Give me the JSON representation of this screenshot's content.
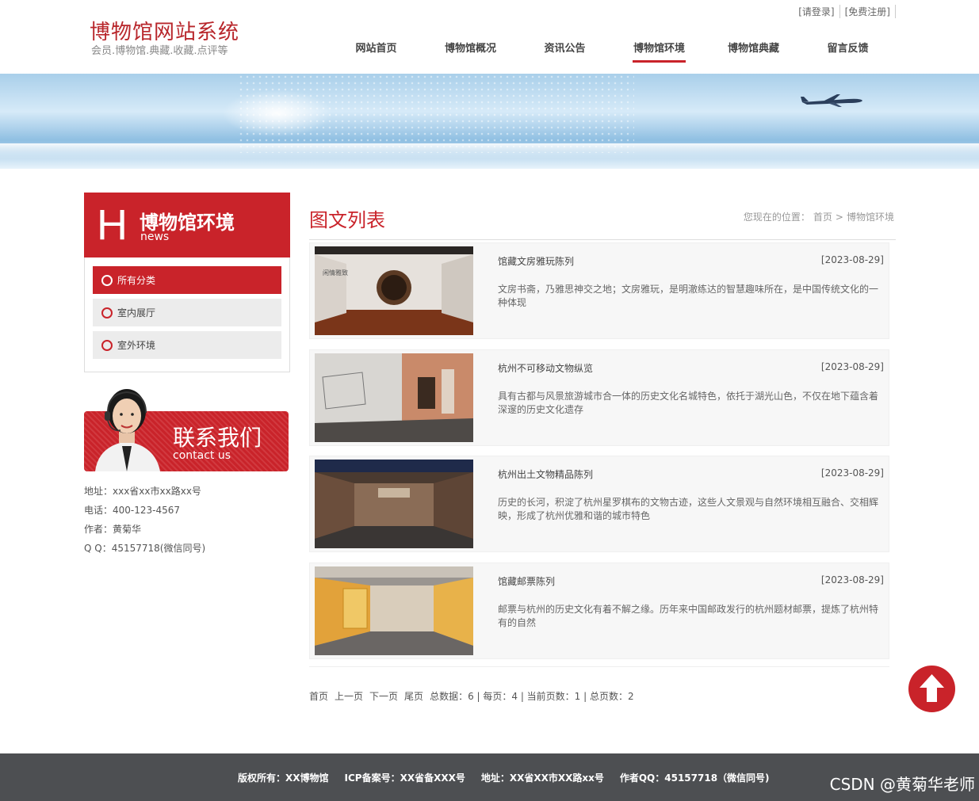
{
  "header": {
    "logo_title": "博物馆网站系统",
    "logo_sub": "会员.博物馆.典藏.收藏.点评等",
    "login_link": "[请登录]",
    "register_link": "[免费注册]",
    "nav": [
      "网站首页",
      "博物馆概况",
      "资讯公告",
      "博物馆环境",
      "博物馆典藏",
      "留言反馈"
    ],
    "nav_active": "博物馆环境"
  },
  "sidebar": {
    "letter": "H",
    "title": "博物馆环境",
    "subtitle": "news",
    "items": [
      "所有分类",
      "室内展厅",
      "室外环境"
    ],
    "contact_zh": "联系我们",
    "contact_en": "contact us",
    "info": {
      "address": "地址：xxx省xx市xx路xx号",
      "phone": "电话：400-123-4567",
      "author": "作者：黄菊华",
      "qq": "Q Q：45157718(微信同号)"
    }
  },
  "main": {
    "title": "图文列表",
    "breadcrumb": {
      "prefix": "您现在的位置：",
      "home": "首页",
      "sep": ">",
      "current": "博物馆环境"
    },
    "items": [
      {
        "title": "馆藏文房雅玩陈列",
        "date": "[2023-08-29]",
        "desc": "文房书斋，乃雅思神交之地；文房雅玩，是明澈练达的智慧趣味所在，是中国传统文化的一种体现"
      },
      {
        "title": "杭州不可移动文物纵览",
        "date": "[2023-08-29]",
        "desc": "具有古都与风景旅游城市合一体的历史文化名城特色，依托于湖光山色，不仅在地下蕴含着深邃的历史文化遗存"
      },
      {
        "title": "杭州出土文物精品陈列",
        "date": "[2023-08-29]",
        "desc": "历史的长河，积淀了杭州星罗棋布的文物古迹，这些人文景观与自然环境相互融合、交相辉映，形成了杭州优雅和谐的城市特色"
      },
      {
        "title": "馆藏邮票陈列",
        "date": "[2023-08-29]",
        "desc": "邮票与杭州的历史文化有着不解之缘。历年来中国邮政发行的杭州题材邮票，提炼了杭州特有的自然"
      }
    ],
    "pager": {
      "first": "首页",
      "prev": "上一页",
      "next": "下一页",
      "last": "尾页",
      "summary": "总数据：6 | 每页：4 | 当前页数：1 | 总页数：2"
    }
  },
  "footer": {
    "copyright": "版权所有：XX博物馆",
    "icp": "ICP备案号：XX省备XXX号",
    "address": "地址：XX省XX市XX路xx号",
    "qq": "作者QQ：45157718（微信同号)",
    "watermark": "CSDN @黄菊华老师"
  },
  "colors": {
    "accent": "#c9232a",
    "footer_bg": "#4d4f52"
  }
}
